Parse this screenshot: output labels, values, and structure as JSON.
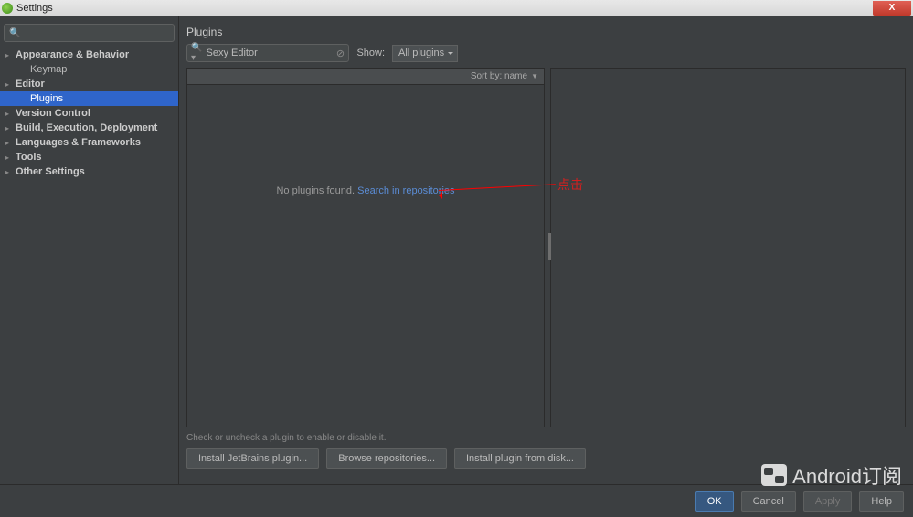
{
  "window": {
    "title": "Settings",
    "close_glyph": "X"
  },
  "sidebar": {
    "search_placeholder": "",
    "items": [
      {
        "label": "Appearance & Behavior",
        "bold": true,
        "arrow": true,
        "level": 0
      },
      {
        "label": "Keymap",
        "bold": false,
        "arrow": false,
        "level": 1
      },
      {
        "label": "Editor",
        "bold": true,
        "arrow": true,
        "level": 0
      },
      {
        "label": "Plugins",
        "bold": false,
        "arrow": false,
        "level": 1,
        "selected": true
      },
      {
        "label": "Version Control",
        "bold": true,
        "arrow": true,
        "level": 0
      },
      {
        "label": "Build, Execution, Deployment",
        "bold": true,
        "arrow": true,
        "level": 0
      },
      {
        "label": "Languages & Frameworks",
        "bold": true,
        "arrow": true,
        "level": 0
      },
      {
        "label": "Tools",
        "bold": true,
        "arrow": true,
        "level": 0
      },
      {
        "label": "Other Settings",
        "bold": true,
        "arrow": true,
        "level": 0
      }
    ]
  },
  "main": {
    "title": "Plugins",
    "search_value": "Sexy Editor",
    "show_label": "Show:",
    "dropdown_value": "All plugins",
    "sort_label": "Sort by: name",
    "empty_text": "No plugins found.",
    "empty_link": "Search in repositories",
    "hint": "Check or uncheck a plugin to enable or disable it.",
    "actions": {
      "install_jb": "Install JetBrains plugin...",
      "browse": "Browse repositories...",
      "install_disk": "Install plugin from disk..."
    }
  },
  "buttons": {
    "ok": "OK",
    "cancel": "Cancel",
    "apply": "Apply",
    "help": "Help"
  },
  "annotation": {
    "text": "点击"
  },
  "watermark": {
    "text": "Android订阅"
  }
}
